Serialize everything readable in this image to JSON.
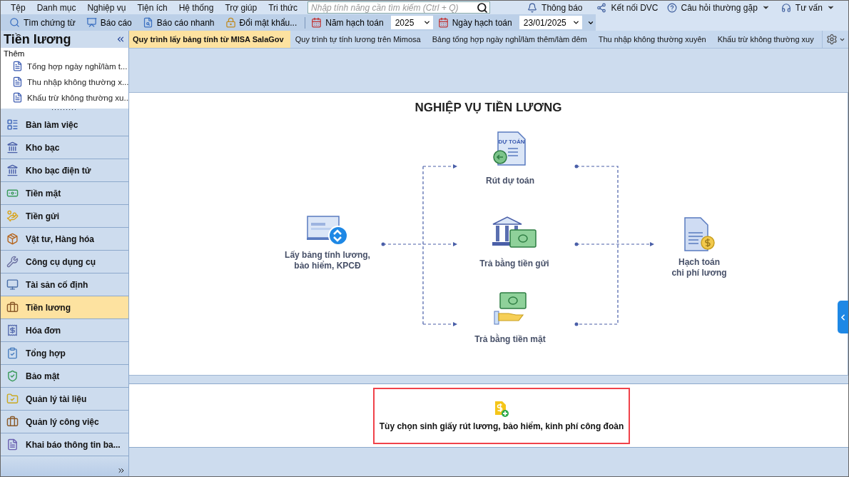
{
  "menu": [
    "Tệp",
    "Danh mục",
    "Nghiệp vụ",
    "Tiện ích",
    "Hệ thống",
    "Trợ giúp",
    "Tri thức"
  ],
  "search": {
    "placeholder": "Nhập tính năng cần tìm kiếm (Ctrl + Q)"
  },
  "top_links": [
    {
      "label": "Thông báo",
      "kind": "bell",
      "dropdown": false
    },
    {
      "label": "Kết nối DVC",
      "kind": "connect",
      "dropdown": false
    },
    {
      "label": "Câu hỏi thường gặp",
      "kind": "help",
      "dropdown": true
    },
    {
      "label": "Tư vấn",
      "kind": "headset",
      "dropdown": true
    }
  ],
  "toolbar": [
    {
      "label": "Tìm chứng từ",
      "kind": "search"
    },
    {
      "label": "Báo cáo",
      "kind": "report"
    },
    {
      "label": "Báo cáo nhanh",
      "kind": "quick"
    },
    {
      "label": "Đổi mật khẩu...",
      "kind": "lock"
    }
  ],
  "year": {
    "label": "Năm hạch toán",
    "value": "2025"
  },
  "date": {
    "label": "Ngày hạch toán",
    "value": "23/01/2025"
  },
  "sidebar": {
    "title": "Tiền lương",
    "more_label": "Thêm",
    "recent": [
      "Tổng hợp ngày nghỉ/làm t...",
      "Thu nhập không thường x...",
      "Khấu trừ không thường xu..."
    ],
    "nav": [
      {
        "label": "Bàn làm việc",
        "selected": false
      },
      {
        "label": "Kho bạc",
        "selected": false
      },
      {
        "label": "Kho bạc điện tử",
        "selected": false
      },
      {
        "label": "Tiền mặt",
        "selected": false
      },
      {
        "label": "Tiền gửi",
        "selected": false
      },
      {
        "label": "Vật tư, Hàng hóa",
        "selected": false
      },
      {
        "label": "Công cụ dụng cụ",
        "selected": false
      },
      {
        "label": "Tài sản cố định",
        "selected": false
      },
      {
        "label": "Tiền lương",
        "selected": true
      },
      {
        "label": "Hóa đơn",
        "selected": false
      },
      {
        "label": "Tổng hợp",
        "selected": false
      },
      {
        "label": "Bảo mật",
        "selected": false
      },
      {
        "label": "Quản lý tài liệu",
        "selected": false
      },
      {
        "label": "Quản lý công việc",
        "selected": false
      },
      {
        "label": "Khai báo thông tin ba...",
        "selected": false
      }
    ]
  },
  "tabs": [
    {
      "label": "Quy trình lấy bảng tính từ MISA SalaGov",
      "selected": true
    },
    {
      "label": "Quy trình tự tính lương trên Mimosa",
      "selected": false
    },
    {
      "label": "Bảng tổng hợp ngày nghỉ/làm thêm/làm đêm",
      "selected": false
    },
    {
      "label": "Thu nhập không thường xuyên",
      "selected": false
    },
    {
      "label": "Khấu trừ không thường xuy",
      "selected": false
    }
  ],
  "diagram": {
    "title": "NGHIỆP VỤ TIỀN LƯƠNG",
    "nodes": [
      {
        "kind": "source",
        "lines": [
          "Lấy bảng tính lương,",
          "bảo hiểm, KPCĐ"
        ]
      },
      {
        "kind": "budget",
        "lines": [
          "Rút dự toán"
        ],
        "icon_text": "DỰ TOÁN"
      },
      {
        "kind": "bank",
        "lines": [
          "Trả bằng tiền gửi"
        ]
      },
      {
        "kind": "cash",
        "lines": [
          "Trả bằng tiền mặt"
        ]
      },
      {
        "kind": "accounting",
        "lines": [
          "Hạch toán",
          "chi phí lương"
        ]
      }
    ]
  },
  "option": {
    "label": "Tùy chọn sinh giấy rút lương, bảo hiểm, kinh phí công đoàn"
  }
}
